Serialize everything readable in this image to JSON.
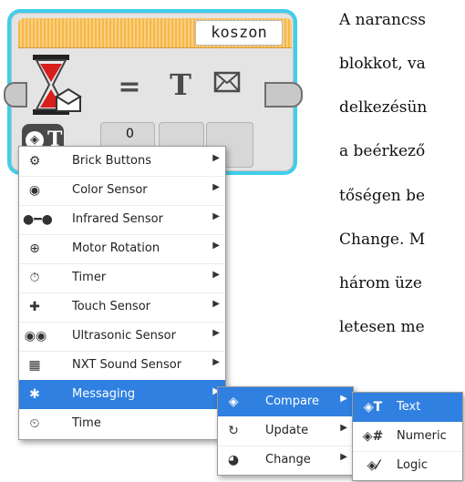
{
  "background_text": {
    "lines": [
      "A narancss",
      "blokkot, va",
      "delkezésün",
      "a beérkező",
      "tőségen be",
      "Change. M",
      "három üze",
      "letesen me"
    ]
  },
  "block": {
    "label": "koszon",
    "operator_symbol": "=",
    "text_symbol": "T",
    "mode_symbol": "T",
    "input_value": "0",
    "icons": [
      "hourglass-icon",
      "envelope-icon",
      "text-icon",
      "message-icon"
    ],
    "colors": {
      "header": "#f7b74a",
      "selection_glow": "#00bee6"
    }
  },
  "menu1": {
    "items": [
      {
        "label": "Brick Buttons",
        "icon": "brick-buttons-icon",
        "arrow": "▶"
      },
      {
        "label": "Color Sensor",
        "icon": "color-sensor-icon",
        "arrow": "▶"
      },
      {
        "label": "Infrared Sensor",
        "icon": "infrared-sensor-icon",
        "arrow": "▶"
      },
      {
        "label": "Motor Rotation",
        "icon": "motor-rotation-icon",
        "arrow": "▶"
      },
      {
        "label": "Timer",
        "icon": "timer-icon",
        "arrow": "▶"
      },
      {
        "label": "Touch Sensor",
        "icon": "touch-sensor-icon",
        "arrow": "▶"
      },
      {
        "label": "Ultrasonic Sensor",
        "icon": "ultrasonic-sensor-icon",
        "arrow": "▶"
      },
      {
        "label": "NXT Sound Sensor",
        "icon": "sound-sensor-icon",
        "arrow": "▶"
      },
      {
        "label": "Messaging",
        "icon": "bluetooth-icon",
        "arrow": "▶",
        "selected": true
      },
      {
        "label": "Time",
        "icon": "stopwatch-icon",
        "arrow": ""
      }
    ]
  },
  "menu2": {
    "items": [
      {
        "label": "Compare",
        "icon": "compare-icon",
        "arrow": "▶",
        "selected": true
      },
      {
        "label": "Update",
        "icon": "update-icon",
        "arrow": "▶"
      },
      {
        "label": "Change",
        "icon": "change-icon",
        "arrow": "▶"
      }
    ]
  },
  "menu3": {
    "items": [
      {
        "label": "Text",
        "icon": "text-compare-icon",
        "prefix": "T",
        "selected": true
      },
      {
        "label": "Numeric",
        "icon": "numeric-compare-icon",
        "prefix": "#"
      },
      {
        "label": "Logic",
        "icon": "logic-compare-icon",
        "prefix": "⁄"
      }
    ]
  },
  "colors": {
    "selection": "#2f80e0"
  }
}
